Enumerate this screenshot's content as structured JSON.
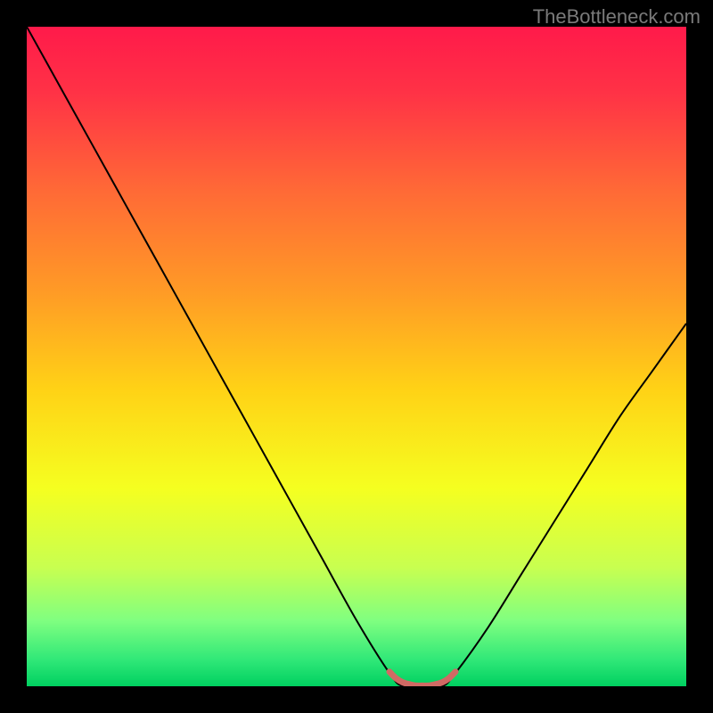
{
  "watermark": "TheBottleneck.com",
  "chart_data": {
    "type": "line",
    "title": "",
    "xlabel": "",
    "ylabel": "",
    "xlim": [
      0,
      100
    ],
    "ylim": [
      0,
      100
    ],
    "grid": false,
    "series": [
      {
        "name": "bottleneck-curve",
        "x": [
          0,
          5,
          10,
          15,
          20,
          25,
          30,
          35,
          40,
          45,
          50,
          55,
          57,
          60,
          63,
          65,
          70,
          75,
          80,
          85,
          90,
          95,
          100
        ],
        "y": [
          100,
          91,
          82,
          73,
          64,
          55,
          46,
          37,
          28,
          19,
          10,
          2,
          0,
          0,
          0,
          2,
          9,
          17,
          25,
          33,
          41,
          48,
          55
        ]
      },
      {
        "name": "optimal-range-marker",
        "x": [
          55,
          56,
          57,
          58,
          59,
          60,
          61,
          62,
          63,
          64,
          65
        ],
        "y": [
          2.2,
          1.2,
          0.6,
          0.3,
          0.1,
          0.1,
          0.1,
          0.3,
          0.6,
          1.2,
          2.2
        ]
      }
    ],
    "background_gradient": {
      "stops": [
        {
          "offset": 0.0,
          "color": "#ff1a4a"
        },
        {
          "offset": 0.1,
          "color": "#ff3246"
        },
        {
          "offset": 0.25,
          "color": "#ff6a36"
        },
        {
          "offset": 0.4,
          "color": "#ff9a26"
        },
        {
          "offset": 0.55,
          "color": "#ffd216"
        },
        {
          "offset": 0.7,
          "color": "#f5ff20"
        },
        {
          "offset": 0.82,
          "color": "#c8ff50"
        },
        {
          "offset": 0.9,
          "color": "#80ff80"
        },
        {
          "offset": 0.96,
          "color": "#30e878"
        },
        {
          "offset": 1.0,
          "color": "#00d060"
        }
      ]
    },
    "curve_color": "#000000",
    "marker_color": "#d06a64"
  }
}
